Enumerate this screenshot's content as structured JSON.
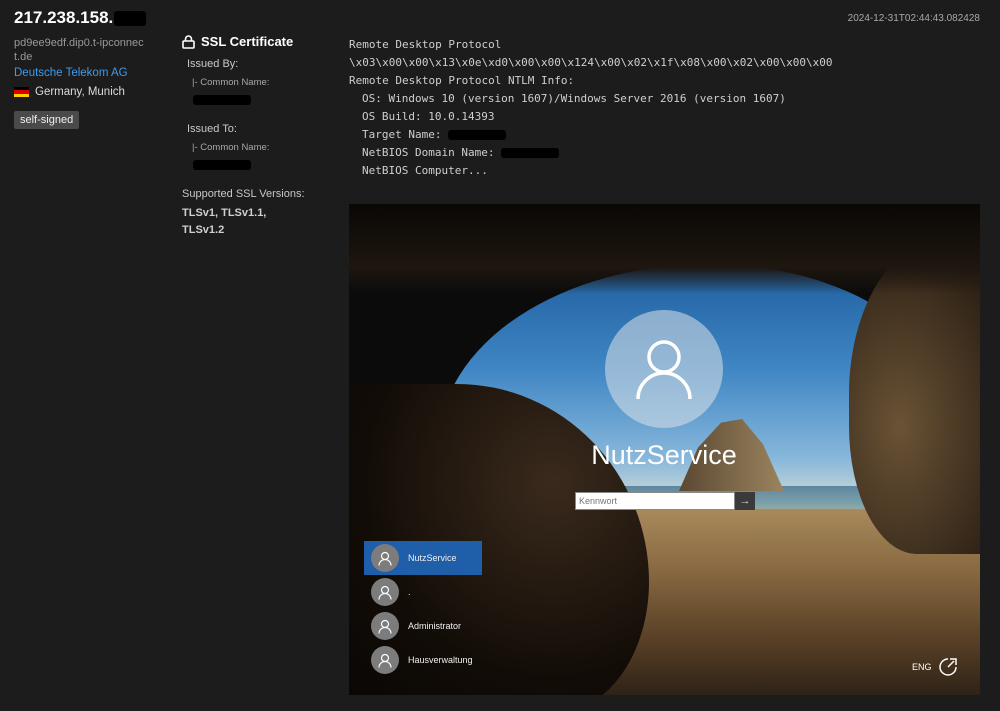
{
  "host": {
    "ip": "217.238.158.",
    "hostname": "pd9ee9edf.dip0.t-ipconnect.de",
    "organization": "Deutsche Telekom AG",
    "location": "Germany, Munich",
    "tag": "self-signed",
    "flag_colors": [
      "#000000",
      "#dd0000",
      "#ffce00"
    ]
  },
  "timestamp": "2024-12-31T02:44:43.082428",
  "ssl": {
    "title": "SSL Certificate",
    "issued_by_label": "Issued By:",
    "issued_to_label": "Issued To:",
    "common_name_label": "|- Common Name:",
    "supported_label": "Supported SSL Versions:",
    "versions": "TLSv1, TLSv1.1, TLSv1.2"
  },
  "rdp": {
    "protocol_label": "Remote Desktop Protocol",
    "protocol_bytes": "\\x03\\x00\\x00\\x13\\x0e\\xd0\\x00\\x00\\x124\\x00\\x02\\x1f\\x08\\x00\\x02\\x00\\x00\\x00",
    "ntlm_label": "Remote Desktop Protocol NTLM Info:",
    "os_line": "OS: Windows 10 (version 1607)/Windows Server 2016 (version 1607)",
    "os_build_line": "OS Build: 10.0.14393",
    "target_name_label": "Target Name:",
    "netbios_domain_label": "NetBIOS Domain Name:",
    "netbios_computer_line": "NetBIOS Computer..."
  },
  "login_screen": {
    "username": "NutzService",
    "password_placeholder": "Kennwort",
    "submit_glyph": "→",
    "users": [
      {
        "name": "NutzService",
        "active": true
      },
      {
        "name": ".",
        "active": false
      },
      {
        "name": "Administrator",
        "active": false
      },
      {
        "name": "Hausverwaltung",
        "active": false
      }
    ],
    "language": "ENG",
    "accent_color": "#1f5ea8"
  }
}
